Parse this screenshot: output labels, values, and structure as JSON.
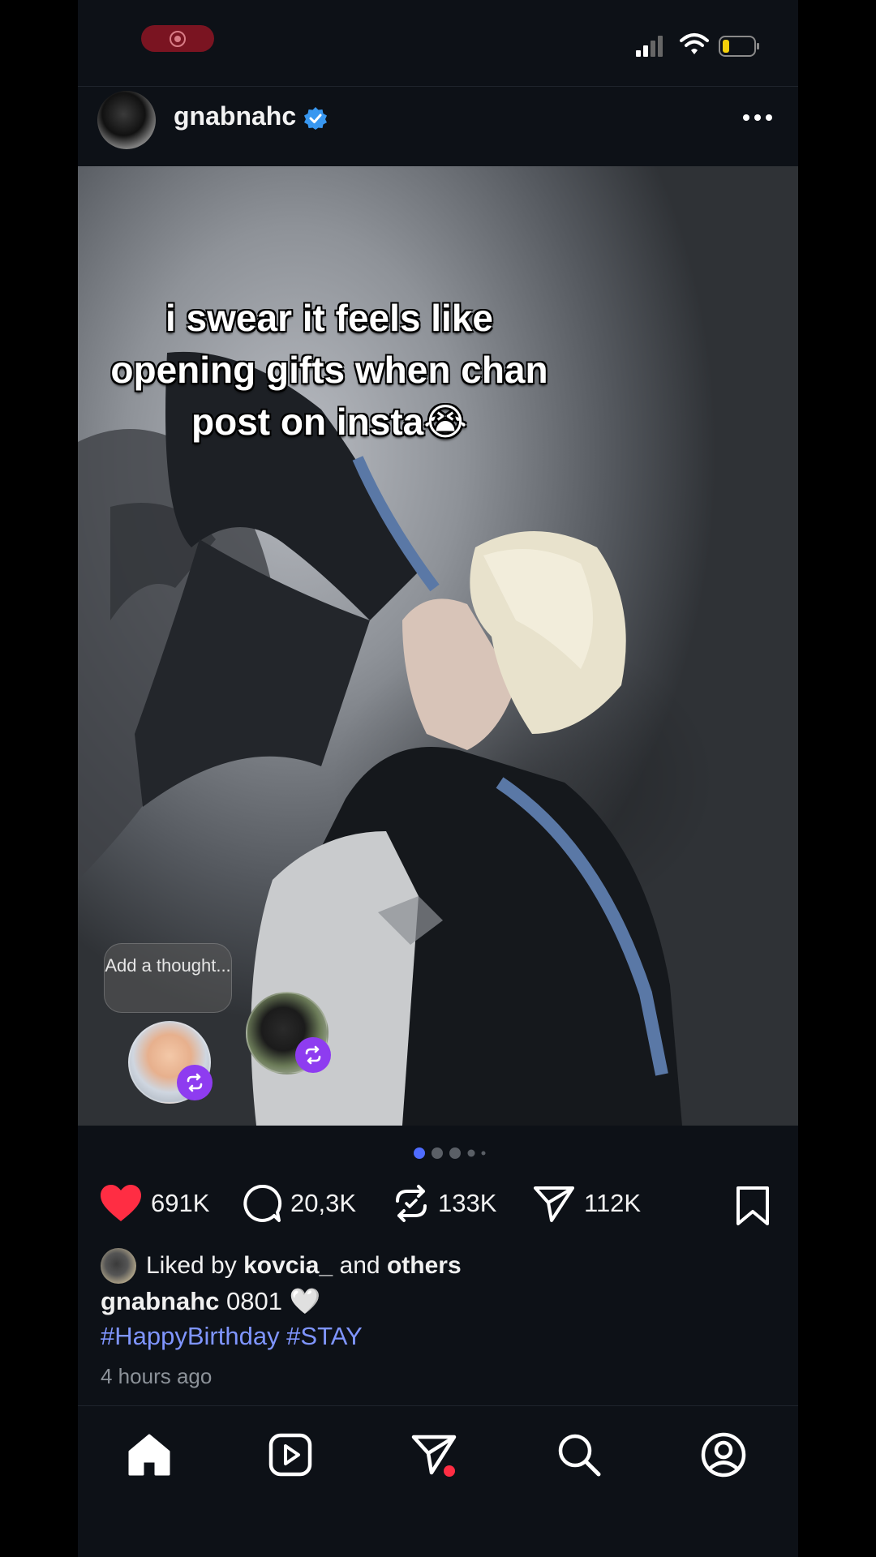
{
  "post": {
    "username": "gnabnahc",
    "caption_overlay": "i swear it feels like opening gifts when chan post on insta😭",
    "add_thought": "Add a thought...",
    "stats": {
      "likes": "691K",
      "comments": "20,3K",
      "reposts": "133K",
      "shares": "112K"
    },
    "liked_by_prefix": "Liked by",
    "liked_by_user": "kovcia_",
    "liked_by_and": "and",
    "liked_by_others": "others",
    "caption_user": "gnabnahc",
    "caption_text": "0801 🤍",
    "hashtags": "#HappyBirthday #STAY",
    "time_ago": "4 hours ago",
    "carousel": {
      "total": 5,
      "active": 1
    }
  },
  "colors": {
    "background": "#0d1117",
    "like_red": "#ff2d43",
    "hashtag_blue": "#7f95ff",
    "verified_blue": "#3897f0",
    "repost_purple": "#8e3cf0",
    "dot_active": "#4f6cff",
    "notification_red": "#ff2d43"
  },
  "icons": {
    "header": [
      "avatar",
      "verified-badge-icon",
      "more-icon"
    ],
    "actions": [
      "heart-icon",
      "comment-icon",
      "repost-icon",
      "share-icon",
      "bookmark-icon"
    ],
    "nav": [
      "home-icon",
      "reels-icon",
      "messages-icon",
      "search-icon",
      "profile-icon"
    ]
  }
}
